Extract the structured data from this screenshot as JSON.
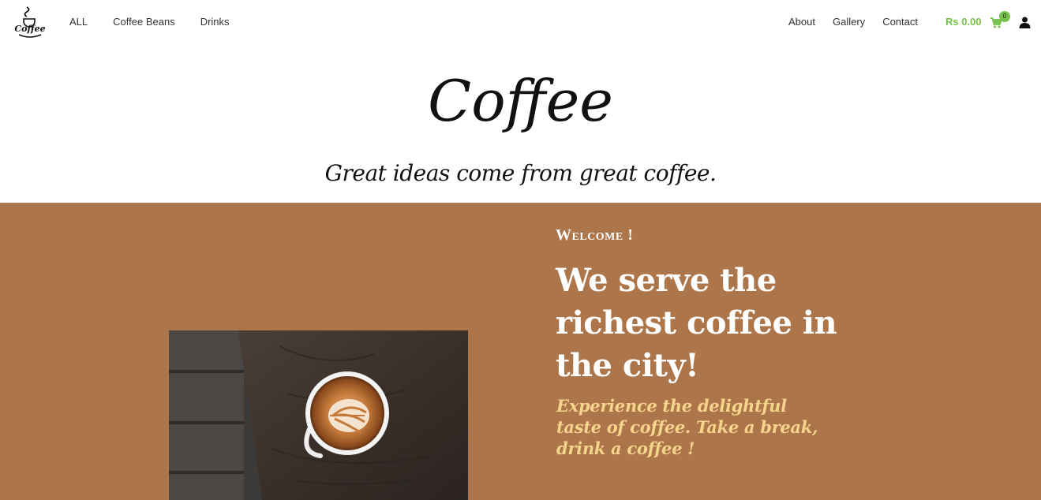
{
  "nav": {
    "logo_text": "Coffee",
    "left_links": [
      {
        "label": "ALL"
      },
      {
        "label": "Coffee Beans"
      },
      {
        "label": "Drinks"
      }
    ],
    "right_links": [
      {
        "label": "About"
      },
      {
        "label": "Gallery"
      },
      {
        "label": "Contact"
      }
    ],
    "cart_total": "Rs 0.00",
    "cart_count": "0",
    "cart_icon": "shopping-cart-icon",
    "user_icon": "user-icon"
  },
  "header": {
    "title": "Coffee",
    "tagline": "Great ideas come from great coffee."
  },
  "hero": {
    "eyebrow": "Welcome !",
    "headline": "We serve the richest coffee in the city!",
    "subtext": "Experience the delightful taste of coffee. Take a break, drink a coffee !"
  },
  "colors": {
    "hero_bg": "#ad754a",
    "accent_green": "#77c24a",
    "subtext_yellow": "#f6d48b"
  }
}
